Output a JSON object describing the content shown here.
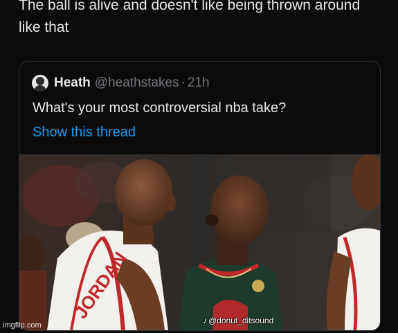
{
  "post": {
    "text": "The ball is alive and doesn't like being thrown around like that"
  },
  "quoted_tweet": {
    "author_name": "Heath",
    "author_handle": "@heathstakes",
    "separator": "·",
    "time": "21h",
    "text": "What's your most controversial nba take?",
    "show_thread_label": "Show this thread"
  },
  "media": {
    "jersey_text": "JORDAN",
    "watermark_handle": "@donut_ditsound",
    "watermark_icon": "tiktok-icon"
  },
  "site_watermark": "imgflip.com"
}
